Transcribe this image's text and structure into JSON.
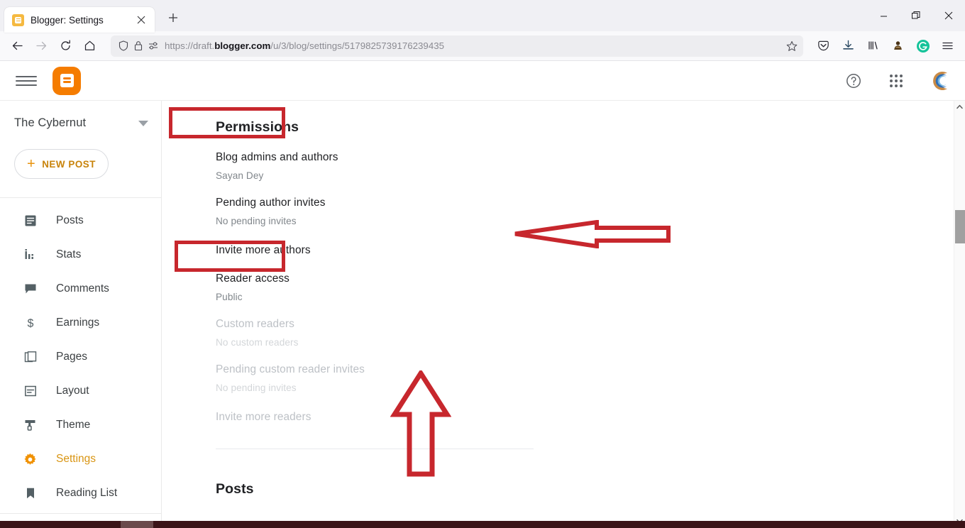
{
  "browser": {
    "tab": {
      "title": "Blogger: Settings",
      "favicon": "blogger-favicon",
      "close_icon": "close-icon"
    },
    "new_tab_icon": "plus-icon",
    "window_controls": {
      "minimize": "minimize-icon",
      "restore": "restore-icon",
      "close": "close-icon"
    },
    "nav": {
      "back_icon": "back-arrow-icon",
      "forward_icon": "forward-arrow-icon",
      "reload_icon": "reload-icon",
      "home_icon": "home-icon"
    },
    "url": {
      "prefix": "https://draft.",
      "domain": "blogger.com",
      "path": "/u/3/blog/settings/5179825739176239435",
      "full": "https://draft.blogger.com/u/3/blog/settings/5179825739176239435",
      "shield_icon": "shield-icon",
      "lock_icon": "lock-icon",
      "permissions_icon": "site-permissions-icon",
      "bookmark_icon": "star-icon"
    },
    "toolbar_icons": [
      "pocket-icon",
      "downloads-icon",
      "library-icon",
      "extension-icon",
      "grammarly-icon",
      "app-menu-icon"
    ]
  },
  "app_header": {
    "menu_icon": "hamburger-menu-icon",
    "logo": "blogger-logo",
    "help_icon": "help-icon",
    "apps_icon": "google-apps-icon",
    "avatar": "user-avatar"
  },
  "sidebar": {
    "blog_name": "The Cybernut",
    "blog_switcher_icon": "chevron-down-icon",
    "new_post_label": "NEW POST",
    "new_post_icon": "plus-icon",
    "items": [
      {
        "label": "Posts",
        "icon": "posts-icon",
        "active": false
      },
      {
        "label": "Stats",
        "icon": "stats-icon",
        "active": false
      },
      {
        "label": "Comments",
        "icon": "comments-icon",
        "active": false
      },
      {
        "label": "Earnings",
        "icon": "earnings-dollar-icon",
        "active": false
      },
      {
        "label": "Pages",
        "icon": "pages-icon",
        "active": false
      },
      {
        "label": "Layout",
        "icon": "layout-icon",
        "active": false
      },
      {
        "label": "Theme",
        "icon": "theme-brush-icon",
        "active": false
      },
      {
        "label": "Settings",
        "icon": "settings-gear-icon",
        "active": true
      },
      {
        "label": "Reading List",
        "icon": "reading-list-bookmark-icon",
        "active": false
      }
    ]
  },
  "main": {
    "section_title": "Permissions",
    "rows": [
      {
        "label": "Blog admins and authors",
        "value": "Sayan Dey",
        "muted": false
      },
      {
        "label": "Pending author invites",
        "value": "No pending invites",
        "muted": false
      }
    ],
    "invite_authors_link": "Invite more authors",
    "reader_rows": [
      {
        "label": "Reader access",
        "value": "Public",
        "muted": false
      },
      {
        "label": "Custom readers",
        "value": "No custom readers",
        "muted": true
      },
      {
        "label": "Pending custom reader invites",
        "value": "No pending invites",
        "muted": true
      }
    ],
    "invite_readers_link": "Invite more readers",
    "next_section_title": "Posts"
  },
  "annotations": {
    "color": "#c7272d",
    "boxes": [
      {
        "name": "permissions-highlight-box",
        "target": "Permissions"
      },
      {
        "name": "invite-more-authors-highlight-box",
        "target": "Invite more authors"
      }
    ],
    "arrows": [
      {
        "name": "left-pointing-arrow",
        "direction": "left"
      },
      {
        "name": "up-pointing-arrow",
        "direction": "up"
      }
    ]
  },
  "scrollbar": {
    "up_icon": "scroll-up-icon",
    "down_icon": "scroll-down-icon",
    "thumb": "scroll-thumb"
  }
}
